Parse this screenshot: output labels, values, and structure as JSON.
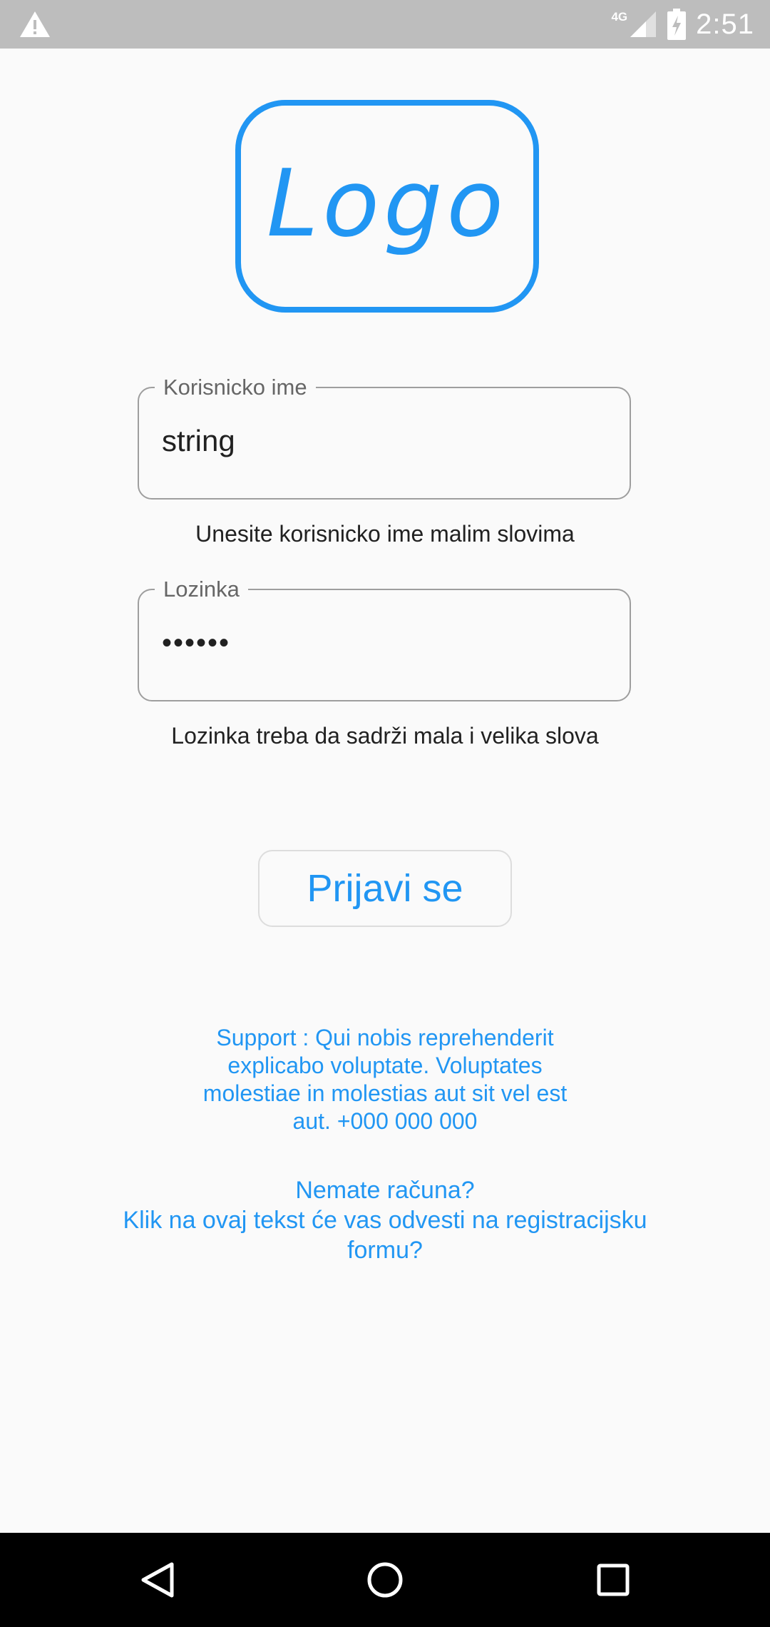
{
  "status_bar": {
    "warning_icon": "warning-icon",
    "network_type": "4G",
    "signal_icon": "signal-icon",
    "battery_icon": "battery-charging-icon",
    "time": "2:51"
  },
  "logo": {
    "text": "Logo",
    "color": "#2196f3"
  },
  "username_field": {
    "label": "Korisnicko ime",
    "value": "string",
    "helper": "Unesite korisnicko ime malim slovima"
  },
  "password_field": {
    "label": "Lozinka",
    "value": "••••••",
    "helper": "Lozinka treba da sadrži mala i velika slova"
  },
  "login_button": {
    "label": "Prijavi se"
  },
  "support": {
    "text": "Support : Qui nobis reprehenderit explicabo voluptate. Voluptates molestiae in molestias aut sit vel est aut. +000 000 000"
  },
  "register": {
    "line1": "Nemate računa?",
    "line2": "Klik na ovaj tekst će vas odvesti na registracijsku formu?"
  },
  "nav_bar": {
    "back_icon": "back-icon",
    "home_icon": "home-icon",
    "recents_icon": "recents-icon"
  },
  "colors": {
    "accent": "#2196f3",
    "status_bar": "#bdbdbd",
    "background": "#fafafa",
    "nav_bar": "#000000"
  }
}
